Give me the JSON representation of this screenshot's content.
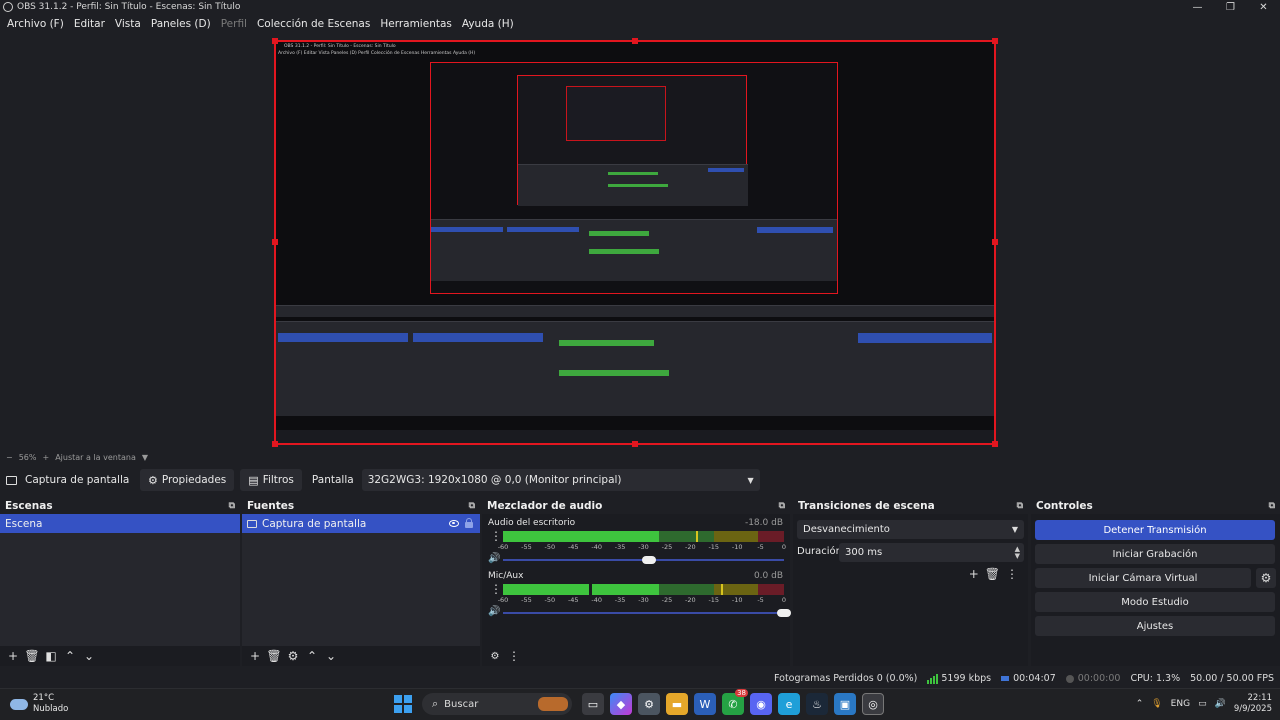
{
  "window": {
    "title": "OBS 31.1.2 - Perfil: Sin Título - Escenas: Sin Título",
    "controls": [
      "minimize",
      "maximize",
      "close"
    ]
  },
  "menu": [
    {
      "label": "Archivo (F)",
      "disabled": false
    },
    {
      "label": "Editar",
      "disabled": false
    },
    {
      "label": "Vista",
      "disabled": false
    },
    {
      "label": "Paneles (D)",
      "disabled": false
    },
    {
      "label": "Perfil",
      "disabled": true
    },
    {
      "label": "Colección de Escenas",
      "disabled": false
    },
    {
      "label": "Herramientas",
      "disabled": false
    },
    {
      "label": "Ayuda (H)",
      "disabled": false
    }
  ],
  "preview": {
    "zoom": "56%",
    "zoom_action": "Ajustar a la ventana",
    "mini_title": "OBS 31.1.2 - Perfil: Sin Título - Escenas: Sin Título",
    "mini_menu": "Archivo (F)   Editar   Vista   Paneles (D)   Perfil   Colección de Escenas   Herramientas   Ayuda (H)"
  },
  "source_toolbar": {
    "source_name": "Captura de pantalla",
    "properties_label": "Propiedades",
    "filters_label": "Filtros",
    "display_label": "Pantalla",
    "display_value": "32G2WG3: 1920x1080 @ 0,0 (Monitor principal)"
  },
  "scenes": {
    "title": "Escenas",
    "items": [
      "Escena"
    ]
  },
  "sources": {
    "title": "Fuentes",
    "items": [
      "Captura de pantalla"
    ]
  },
  "mixer": {
    "title": "Mezclador de audio",
    "channels": [
      {
        "name": "Audio del escritorio",
        "db": "-18.0 dB",
        "volume": 0.52
      },
      {
        "name": "Mic/Aux",
        "db": "0.0 dB",
        "volume": 1.0
      }
    ],
    "ticks": [
      "-60",
      "-55",
      "-50",
      "-45",
      "-40",
      "-35",
      "-30",
      "-25",
      "-20",
      "-15",
      "-10",
      "-5",
      "0"
    ]
  },
  "transitions": {
    "title": "Transiciones de escena",
    "type": "Desvanecimiento",
    "duration_label": "Duración",
    "duration_value": "300 ms"
  },
  "controls": {
    "title": "Controles",
    "stop_stream": "Detener Transmisión",
    "start_recording": "Iniciar Grabación",
    "start_virtual_cam": "Iniciar Cámara Virtual",
    "studio_mode": "Modo Estudio",
    "settings": "Ajustes"
  },
  "status": {
    "dropped_frames": "Fotogramas Perdidos 0 (0.0%)",
    "bitrate": "5199 kbps",
    "stream_time": "00:04:07",
    "rec_time": "00:00:00",
    "cpu": "CPU: 1.3%",
    "fps": "50.00 / 50.00 FPS"
  },
  "taskbar": {
    "temp": "21°C",
    "weather": "Nublado",
    "search": "Buscar",
    "lang": "ENG",
    "time": "22:11",
    "date": "9/9/2025",
    "badge": "38"
  },
  "colors": {
    "accent": "#3552c4",
    "selection_red": "#e2161f",
    "meter_green": "#3ec43e",
    "meter_yellow": "#c9b81f",
    "meter_red": "#c4233a"
  }
}
